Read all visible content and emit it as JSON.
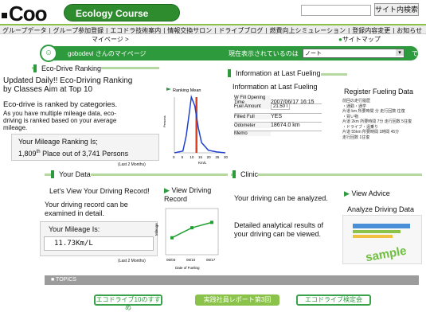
{
  "header": {
    "logo": "Coo",
    "course": "Ecology Course",
    "search_button": "サイト内検索"
  },
  "nav": [
    "グループデータ",
    "グループ参加登録",
    "エコドラ技術案内",
    "情報交換サロン",
    "ドライブブログ",
    "燃費向上シミュレーション",
    "登録内容変更",
    "お知らせ"
  ],
  "subnav": {
    "mypage": "マイページ >",
    "sitemap": "サイトマップ"
  },
  "mypage_bar": {
    "user": "gobodevi さんのマイページ",
    "label": "現在表示されているのは",
    "select_value": "ノート",
    "suffix": "です"
  },
  "ranking": {
    "title": "Eco-Drive Ranking",
    "line1": "Updated Daily!! Eco-Driving Ranking",
    "line2": "by Classes Aim at Top 10",
    "line3": "Eco-drive is ranked by categories.",
    "line4": "As you have multiple mileage data, eco-",
    "line5": "driving is ranked based on your average",
    "line6": "mileage.",
    "rank_label": "Your Mileage Ranking Is;",
    "rank_value": "1,809",
    "rank_sup": "th",
    "rank_rest": "Place out of 3,741 Persons",
    "note": "(Last 2 Months)"
  },
  "rank_chart": {
    "title": "Ranking  Mean",
    "ylabel": "Persons",
    "xlabel": "Km/L",
    "ticks": [
      "0",
      "5",
      "10",
      "15",
      "20",
      "25",
      "30"
    ]
  },
  "fueling": {
    "title": "Information at Last Fueling",
    "subtitle": "Information at Last Fueling",
    "rows": [
      {
        "label": "W Fill Opening Time",
        "value": "2007/06/17 16:15"
      },
      {
        "label": "Fuel Amount",
        "value": "21.50 l"
      },
      {
        "label": "Filled Full",
        "value": "YES"
      },
      {
        "label": "Odometer",
        "value": "18674.0 km"
      },
      {
        "label": "Memo",
        "value": ""
      }
    ]
  },
  "register": {
    "title": "Register Fueling Data",
    "lines": [
      "前回の走行履歴",
      "・通勤・通学",
      "片道 km  所要時間 分  走行回数 往復",
      "・買い物",
      "片道 2km  所要時間 7分  走行回数 5往復",
      "・ドライブ・遠乗り",
      "片道 55km  所要時間 1時間 45分",
      "走行回数 1往復"
    ]
  },
  "your_data": {
    "title": "Your Data",
    "sub": "Let's View Your Driving Record!",
    "desc1": "Your driving record can be",
    "desc2": "examined in detail.",
    "mileage_label": "Your Mileage Is:",
    "mileage_value": "11.73Km/L",
    "note": "(Last 2 Months)"
  },
  "driving_record": {
    "title1": "View Driving",
    "title2": "Record",
    "ylabel": "Mileage",
    "xlabel": "Date of Fueling",
    "dates": [
      "06/03",
      "06/10",
      "06/17"
    ]
  },
  "clinic": {
    "title": "Clinic",
    "line1": "Your driving can be analyzed.",
    "line2": "Detailed analytical results of",
    "line3": "your driving can be viewed.",
    "advice": "View Advice",
    "analyze": "Analyze Driving Data",
    "sample": "sample"
  },
  "topics": {
    "title": "TOPICS",
    "banners": [
      "エコドライブ10のすすめ",
      "実践社員レポート第3回",
      "エコドライブ検定会"
    ]
  },
  "chart_data": [
    {
      "type": "line",
      "title": "Ranking  Mean",
      "xlabel": "Km/L",
      "ylabel": "Persons",
      "x": [
        0,
        5,
        7,
        9,
        10,
        12,
        14,
        16,
        20,
        25,
        30
      ],
      "y": [
        0,
        2,
        20,
        50,
        65,
        55,
        30,
        12,
        3,
        1,
        0
      ],
      "xlim": [
        0,
        30
      ],
      "mean_x": 13
    },
    {
      "type": "line",
      "title": "",
      "xlabel": "Date of Fueling",
      "ylabel": "Mileage",
      "categories": [
        "06/03",
        "06/10",
        "06/17"
      ],
      "values": [
        10.2,
        11.5,
        12.2
      ]
    }
  ],
  "colors": {
    "brand_green": "#2e9a3e",
    "dark_green": "#1d6b1d"
  }
}
